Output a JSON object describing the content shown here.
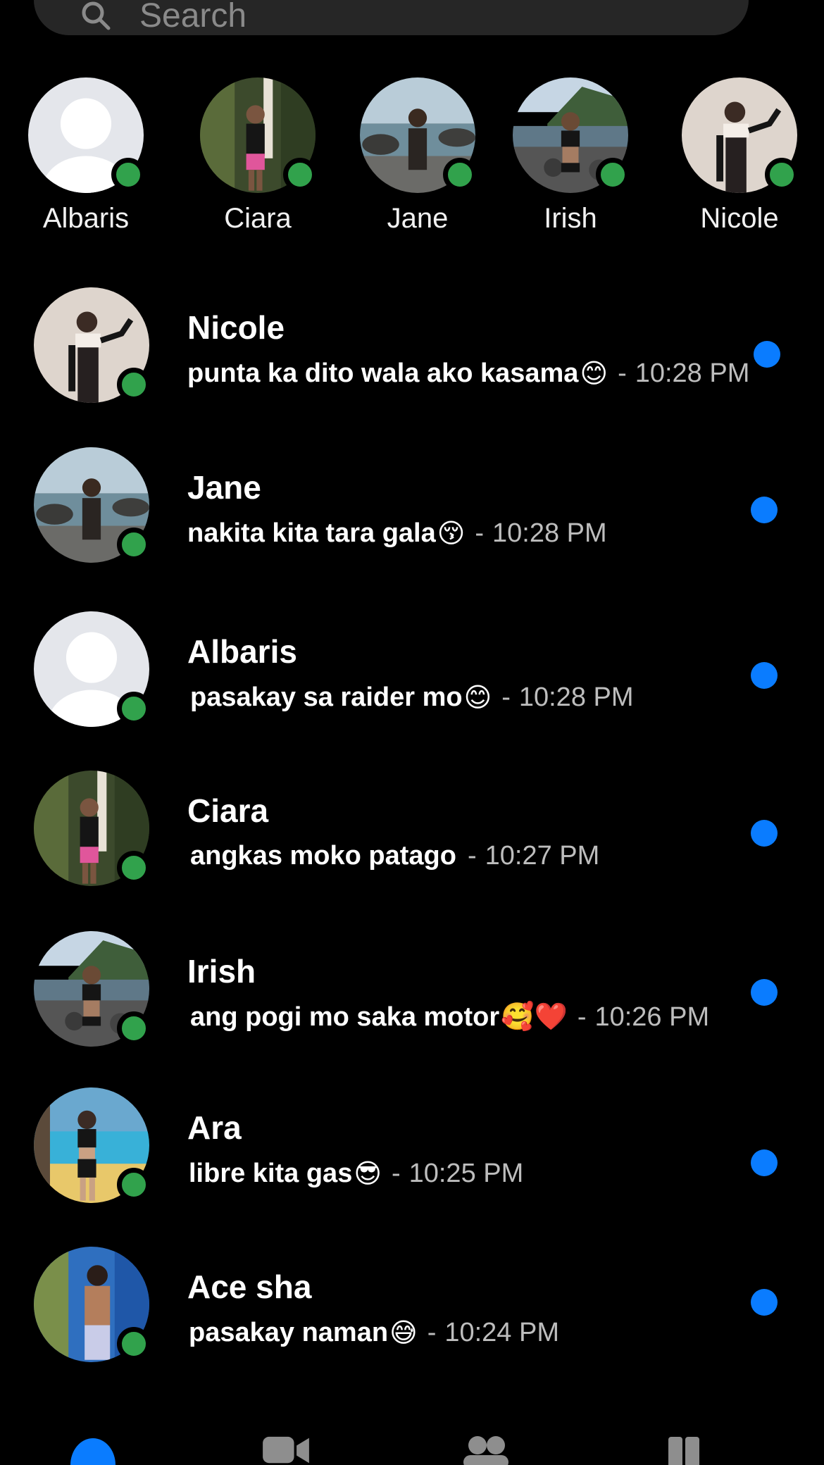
{
  "search": {
    "placeholder": "Search"
  },
  "active_stories": [
    {
      "name": "Albaris",
      "avatar": "default-avatar",
      "online": true
    },
    {
      "name": "Ciara",
      "avatar": "photo-garden",
      "online": true
    },
    {
      "name": "Jane",
      "avatar": "photo-beach-rocks",
      "online": true
    },
    {
      "name": "Irish",
      "avatar": "photo-mountain-shore",
      "online": true
    },
    {
      "name": "Nicole",
      "avatar": "photo-studio",
      "online": true
    }
  ],
  "chats": [
    {
      "name": "Nicole",
      "message": "punta ka dito wala ako kasama",
      "emoji": "😊",
      "separator": "-",
      "time": "10:28 PM",
      "unread": true,
      "online": true
    },
    {
      "name": "Jane",
      "message": "nakita kita tara gala",
      "emoji": "😚",
      "separator": "-",
      "time": "10:28 PM",
      "unread": true,
      "online": true
    },
    {
      "name": "Albaris",
      "message": "pasakay sa raider mo",
      "emoji": "😊",
      "separator": "-",
      "time": "10:28 PM",
      "unread": true,
      "online": true
    },
    {
      "name": "Ciara",
      "message": "angkas moko patago",
      "emoji": "",
      "separator": "-",
      "time": "10:27 PM",
      "unread": true,
      "online": true
    },
    {
      "name": "Irish",
      "message": "ang pogi mo saka motor",
      "emoji": "🥰❤️",
      "separator": "-",
      "time": "10:26 PM",
      "unread": true,
      "online": true
    },
    {
      "name": "Ara",
      "message": "libre kita gas",
      "emoji": "😎",
      "separator": "-",
      "time": "10:25 PM",
      "unread": true,
      "online": true
    },
    {
      "name": "Ace sha",
      "message": "pasakay naman",
      "emoji": "😅",
      "separator": "-",
      "time": "10:24 PM",
      "unread": true,
      "online": true
    }
  ],
  "tabs": [
    {
      "name": "chats",
      "icon": "chat-bubble-icon",
      "active": true
    },
    {
      "name": "calls",
      "icon": "video-camera-icon",
      "active": false
    },
    {
      "name": "people",
      "icon": "people-icon",
      "active": false
    },
    {
      "name": "stories",
      "icon": "stories-icon",
      "active": false
    }
  ],
  "colors": {
    "background": "#000000",
    "online": "#31a24c",
    "unread": "#0a7cff",
    "search_bg": "#262626",
    "timestamp": "#bdbdbd"
  }
}
